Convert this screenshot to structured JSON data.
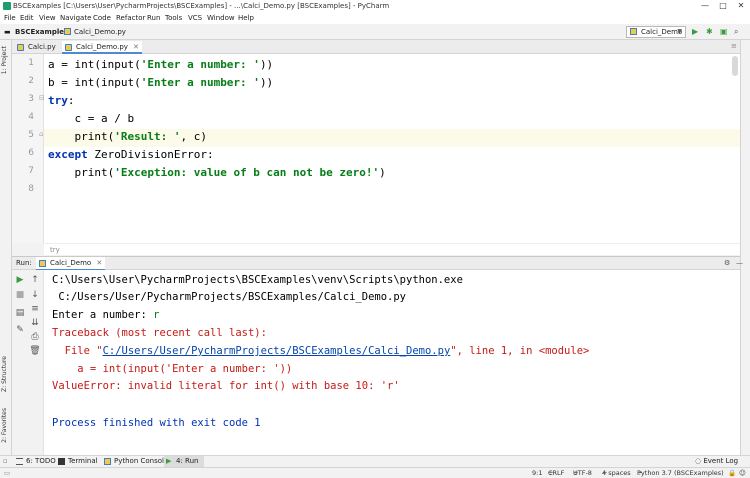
{
  "window": {
    "title": "BSCExamples [C:\\Users\\User\\PycharmProjects\\BSCExamples] - ...\\Calci_Demo.py [BSCExamples] - PyCharm",
    "minimize": "—",
    "maximize": "□",
    "close": "✕"
  },
  "menu": [
    "File",
    "Edit",
    "View",
    "Navigate",
    "Code",
    "Refactor",
    "Run",
    "Tools",
    "VCS",
    "Window",
    "Help"
  ],
  "navbar": {
    "project": "BSCExamples",
    "file": "Calci_Demo.py",
    "run_config": "Calci_Demo"
  },
  "side_tabs": {
    "project": "1: Project",
    "structure": "Z: Structure",
    "favorites": "2: Favorites"
  },
  "editor_tabs": [
    {
      "label": "Calci.py",
      "active": false
    },
    {
      "label": "Calci_Demo.py",
      "active": true
    }
  ],
  "editor": {
    "line_numbers": [
      "1",
      "2",
      "3",
      "4",
      "5",
      "6",
      "7",
      "8"
    ],
    "breadcrumb": "try"
  },
  "run_panel": {
    "title": "Run:",
    "tab": "Calci_Demo",
    "console": {
      "cmd": "C:\\Users\\User\\PycharmProjects\\BSCExamples\\venv\\Scripts\\python.exe",
      "script": " C:/Users/User/PycharmProjects/BSCExamples/Calci_Demo.py",
      "prompt": "Enter a number: ",
      "input": "r",
      "traceback": "Traceback (most recent call last):",
      "file_prefix": "  File \"",
      "file_link": "C:/Users/User/PycharmProjects/BSCExamples/Calci_Demo.py",
      "file_suffix": "\", line 1, in <module>",
      "code_line": "    a = int(input('Enter a number: '))",
      "error": "ValueError: invalid literal for int() with base 10: 'r'",
      "finished": "Process finished with exit code 1"
    }
  },
  "bottom_tabs": [
    "6: TODO",
    "Terminal",
    "Python Console",
    "4: Run"
  ],
  "status": {
    "position": "9:1",
    "line_sep": "CRLF",
    "encoding": "UTF-8",
    "indent": "4 spaces",
    "interpreter": "Python 3.7 (BSCExamples)",
    "event_log": "Event Log"
  },
  "colors": {
    "keyword": "#0033b3",
    "string": "#067d17",
    "error": "#c41a16",
    "link": "#0645ad",
    "active_tab_underline": "#4d8ad6"
  }
}
